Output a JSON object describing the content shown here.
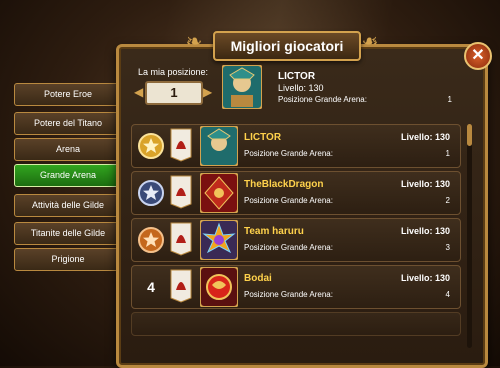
{
  "window": {
    "title": "Migliori giocatori"
  },
  "sidebar": {
    "tabs": [
      {
        "label": "Potere Eroe",
        "active": false
      },
      {
        "label": "Potere del Titano",
        "active": false
      },
      {
        "label": "Arena",
        "active": false
      },
      {
        "label": "Grande Arena",
        "active": true
      },
      {
        "label": "Attività delle Gilde",
        "active": false
      },
      {
        "label": "Titanite delle Gilde",
        "active": false
      },
      {
        "label": "Prigione",
        "active": false
      }
    ]
  },
  "my_position": {
    "label": "La mia posizione:",
    "value": "1"
  },
  "top_player": {
    "name": "LICTOR",
    "level": "Livello: 130",
    "ga_label": "Posizione Grande Arena:",
    "ga_value": "1"
  },
  "leaderboard": [
    {
      "rank_icon": "gold-star-medal",
      "rank": "",
      "name": "LICTOR",
      "level": "Livello: 130",
      "ga_label": "Posizione Grande Arena:",
      "ga_value": "1",
      "avatar": "lictor-avatar"
    },
    {
      "rank_icon": "silver-star-medal",
      "rank": "",
      "name": "TheBlackDragon",
      "level": "Livello: 130",
      "ga_label": "Posizione Grande Arena:",
      "ga_value": "2",
      "avatar": "dragon-avatar"
    },
    {
      "rank_icon": "bronze-star-medal",
      "rank": "",
      "name": "Team haruru",
      "level": "Livello: 130",
      "ga_label": "Posizione Grande Arena:",
      "ga_value": "3",
      "avatar": "sun-avatar"
    },
    {
      "rank_icon": "",
      "rank": "4",
      "name": "Bodai",
      "level": "Livello: 130",
      "ga_label": "Posizione Grande Arena:",
      "ga_value": "4",
      "avatar": "red-dragon-avatar"
    }
  ],
  "colors": {
    "accent_gold": "#b9893f",
    "active_tab": "#2a8a18",
    "name_yellow": "#ffd24c"
  }
}
